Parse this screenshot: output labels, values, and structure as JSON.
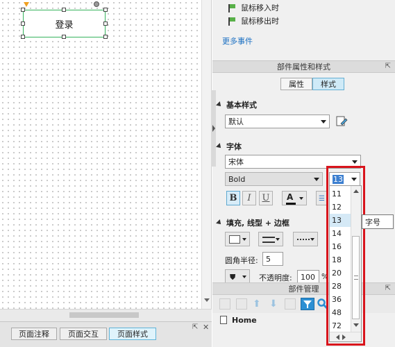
{
  "canvas": {
    "login_button_label": "登录"
  },
  "bottom_tabs": [
    "页面注释",
    "页面交互",
    "页面样式"
  ],
  "events": {
    "items": [
      "鼠标移入时",
      "鼠标移出时"
    ],
    "more_link": "更多事件"
  },
  "properties_panel": {
    "title": "部件属性和样式",
    "tabs": [
      "属性",
      "样式"
    ],
    "basic_style": {
      "label": "基本样式",
      "value": "默认"
    },
    "font": {
      "label": "字体",
      "family": "宋体",
      "weight": "Bold",
      "size": "13",
      "buttons": [
        "B",
        "I",
        "U"
      ]
    },
    "fill": {
      "label": "填充, 线型 + 边框",
      "corner_radius_label": "圆角半径:",
      "corner_radius_value": "5",
      "opacity_label": "不透明度:",
      "opacity_value": "100",
      "opacity_unit": "%"
    }
  },
  "component_manager": {
    "title": "部件管理",
    "page_item": "Home"
  },
  "font_size_dropdown": {
    "options": [
      "11",
      "12",
      "13",
      "14",
      "16",
      "18",
      "20",
      "28",
      "36",
      "48",
      "72"
    ],
    "selected": "13"
  },
  "tooltip": {
    "text": "字号"
  },
  "colors": {
    "highlight": "#d9141c",
    "accent": "#5ea8d0",
    "selection": "#35b35c"
  }
}
